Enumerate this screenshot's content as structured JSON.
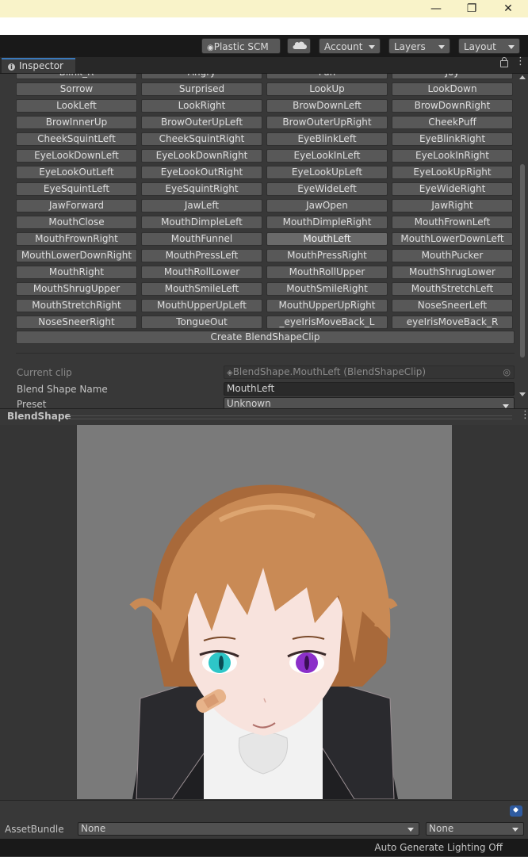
{
  "toolbar": {
    "plastic_scm": "Plastic SCM",
    "account": "Account",
    "layers": "Layers",
    "layout": "Layout"
  },
  "inspector": {
    "tab_label": "Inspector",
    "blendshape_buttons": [
      [
        "Blink_R",
        "Angry",
        "Fun",
        "Joy"
      ],
      [
        "Sorrow",
        "Surprised",
        "LookUp",
        "LookDown"
      ],
      [
        "LookLeft",
        "LookRight",
        "BrowDownLeft",
        "BrowDownRight"
      ],
      [
        "BrowInnerUp",
        "BrowOuterUpLeft",
        "BrowOuterUpRight",
        "CheekPuff"
      ],
      [
        "CheekSquintLeft",
        "CheekSquintRight",
        "EyeBlinkLeft",
        "EyeBlinkRight"
      ],
      [
        "EyeLookDownLeft",
        "EyeLookDownRight",
        "EyeLookInLeft",
        "EyeLookInRight"
      ],
      [
        "EyeLookOutLeft",
        "EyeLookOutRight",
        "EyeLookUpLeft",
        "EyeLookUpRight"
      ],
      [
        "EyeSquintLeft",
        "EyeSquintRight",
        "EyeWideLeft",
        "EyeWideRight"
      ],
      [
        "JawForward",
        "JawLeft",
        "JawOpen",
        "JawRight"
      ],
      [
        "MouthClose",
        "MouthDimpleLeft",
        "MouthDimpleRight",
        "MouthFrownLeft"
      ],
      [
        "MouthFrownRight",
        "MouthFunnel",
        "MouthLeft",
        "MouthLowerDownLeft"
      ],
      [
        "MouthLowerDownRight",
        "MouthPressLeft",
        "MouthPressRight",
        "MouthPucker"
      ],
      [
        "MouthRight",
        "MouthRollLower",
        "MouthRollUpper",
        "MouthShrugLower"
      ],
      [
        "MouthShrugUpper",
        "MouthSmileLeft",
        "MouthSmileRight",
        "MouthStretchLeft"
      ],
      [
        "MouthStretchRight",
        "MouthUpperUpLeft",
        "MouthUpperUpRight",
        "NoseSneerLeft"
      ],
      [
        "NoseSneerRight",
        "TongueOut",
        "_eyeIrisMoveBack_L",
        "eyeIrisMoveBack_R"
      ]
    ],
    "selected_button": "MouthLeft",
    "create_button": "Create BlendShapeClip",
    "current_clip_label": "Current clip",
    "current_clip_value": "BlendShape.MouthLeft (BlendShapeClip)",
    "blend_shape_name_label": "Blend Shape Name",
    "blend_shape_name_value": "MouthLeft",
    "preset_label": "Preset",
    "preset_value": "Unknown"
  },
  "preview": {
    "title": "BlendShape"
  },
  "asset_bundle": {
    "label": "AssetBundle",
    "name_value": "None",
    "variant_value": "None"
  },
  "status": {
    "lighting": "Auto Generate Lighting Off"
  },
  "colors": {
    "tab_accent": "#3a79bb",
    "hair": "#c98a55",
    "eye_left": "#2ec6c8",
    "eye_right": "#8b2fc9"
  }
}
